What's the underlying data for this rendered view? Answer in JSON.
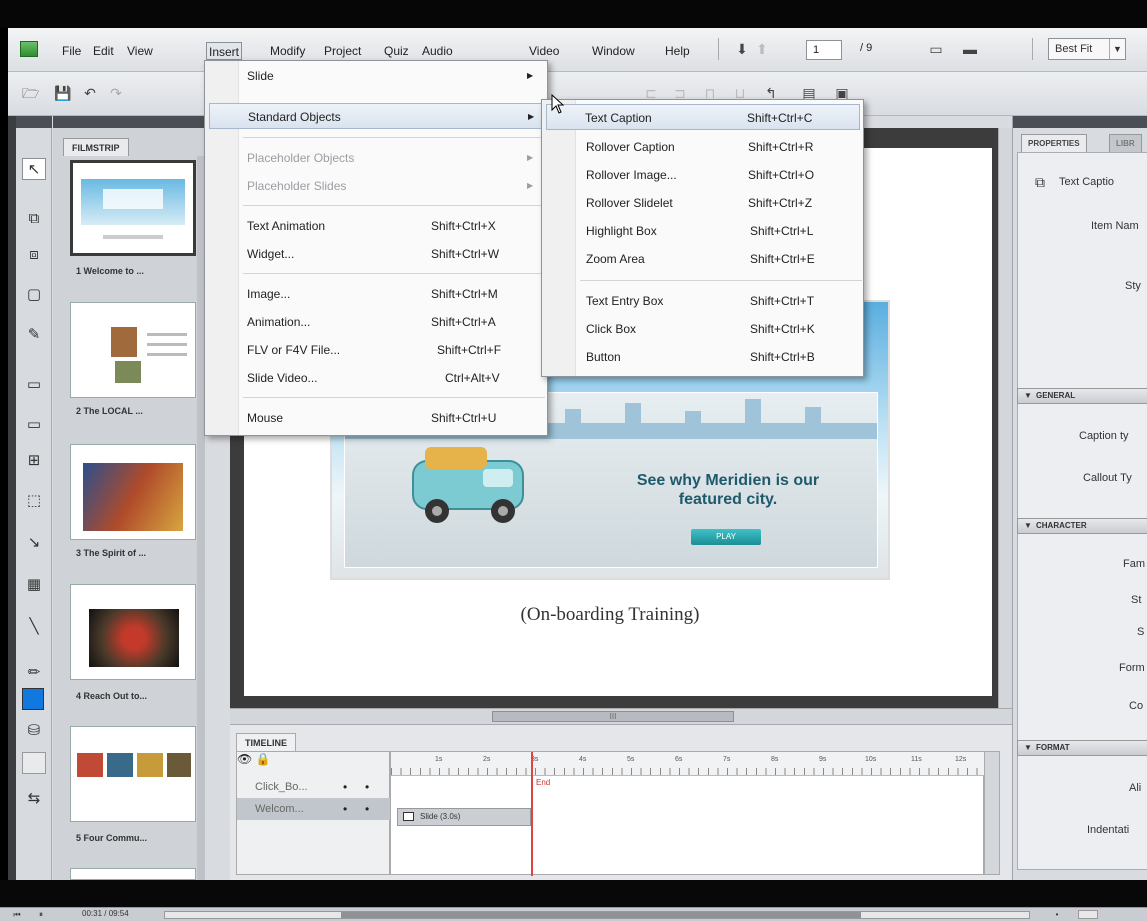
{
  "menubar": {
    "items": [
      "File",
      "Edit",
      "View",
      "Insert",
      "Modify",
      "Project",
      "Quiz",
      "Audio",
      "Video",
      "Window",
      "Help"
    ],
    "page_current": "1",
    "page_total": "/ 9",
    "zoom": "Best Fit"
  },
  "filmstrip": {
    "title": "FILMSTRIP",
    "slides": [
      "1 Welcome to ...",
      "2 The LOCAL ...",
      "3 The Spirit of ...",
      "4 Reach Out to...",
      "5 Four Commu..."
    ]
  },
  "stage": {
    "banner_text": "See why Meridien is our featured city.",
    "play_label": "PLAY",
    "subtitle": "(On-boarding Training)",
    "hscroll_grip": "III"
  },
  "timeline": {
    "tab": "TIMELINE",
    "layers": [
      "Click_Bo...",
      "Welcom..."
    ],
    "slide_bar": "Slide (3.0s)",
    "end_label": "End",
    "ruler": [
      "1s",
      "2s",
      "3s",
      "4s",
      "5s",
      "6s",
      "7s",
      "8s",
      "9s",
      "10s",
      "11s",
      "12s"
    ]
  },
  "properties": {
    "tabs": [
      "PROPERTIES",
      "LIBR"
    ],
    "caption_title": "Text Captio",
    "item_name_label": "Item Nam",
    "style_label": "Sty",
    "sections": {
      "general": "GENERAL",
      "character": "CHARACTER",
      "format": "FORMAT"
    },
    "general_fields": [
      "Caption ty",
      "Callout Ty"
    ],
    "character_fields": [
      "Fam",
      "St",
      "S",
      "Form",
      "Co"
    ],
    "format_fields": [
      "Ali",
      "Indentati"
    ]
  },
  "insert_menu": {
    "items": [
      {
        "label": "Slide",
        "shortcut": "",
        "submenu": true,
        "disabled": false
      },
      {
        "label": "Standard Objects",
        "shortcut": "",
        "submenu": true,
        "disabled": false,
        "highlighted": true
      },
      {
        "label": "Placeholder Objects",
        "shortcut": "",
        "submenu": true,
        "disabled": true
      },
      {
        "label": "Placeholder Slides",
        "shortcut": "",
        "submenu": true,
        "disabled": true
      },
      {
        "label": "Text Animation",
        "shortcut": "Shift+Ctrl+X",
        "submenu": false,
        "disabled": false
      },
      {
        "label": "Widget...",
        "shortcut": "Shift+Ctrl+W",
        "submenu": false,
        "disabled": false
      },
      {
        "label": "Image...",
        "shortcut": "Shift+Ctrl+M",
        "submenu": false,
        "disabled": false
      },
      {
        "label": "Animation...",
        "shortcut": "Shift+Ctrl+A",
        "submenu": false,
        "disabled": false
      },
      {
        "label": "FLV or F4V File...",
        "shortcut": "Shift+Ctrl+F",
        "submenu": false,
        "disabled": false
      },
      {
        "label": "Slide Video...",
        "shortcut": "Ctrl+Alt+V",
        "submenu": false,
        "disabled": false
      },
      {
        "label": "Mouse",
        "shortcut": "Shift+Ctrl+U",
        "submenu": false,
        "disabled": false
      }
    ]
  },
  "standard_objects_menu": {
    "items": [
      {
        "label": "Text Caption",
        "shortcut": "Shift+Ctrl+C",
        "highlighted": true
      },
      {
        "label": "Rollover Caption",
        "shortcut": "Shift+Ctrl+R"
      },
      {
        "label": "Rollover Image...",
        "shortcut": "Shift+Ctrl+O"
      },
      {
        "label": "Rollover Slidelet",
        "shortcut": "Shift+Ctrl+Z"
      },
      {
        "label": "Highlight Box",
        "shortcut": "Shift+Ctrl+L"
      },
      {
        "label": "Zoom Area",
        "shortcut": "Shift+Ctrl+E"
      },
      {
        "label": "Text Entry Box",
        "shortcut": "Shift+Ctrl+T"
      },
      {
        "label": "Click Box",
        "shortcut": "Shift+Ctrl+K"
      },
      {
        "label": "Button",
        "shortcut": "Shift+Ctrl+B"
      }
    ]
  },
  "player": {
    "time": "00:31 / 09:54"
  },
  "colors": {
    "accent": "#1178e0",
    "playhead": "#dd4444"
  }
}
